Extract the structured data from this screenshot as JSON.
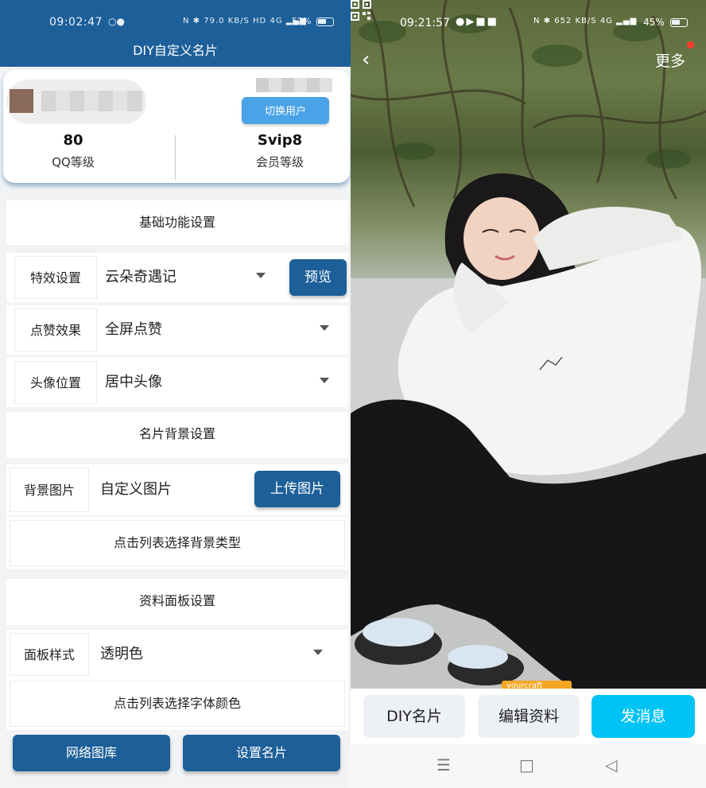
{
  "left": {
    "status": {
      "time": "09:02:47",
      "net_speed": "79.0 KB/S",
      "battery": "52%"
    },
    "title": "DIY自定义名片",
    "user": {
      "switch_button": "切换用户",
      "qq_level_value": "80",
      "qq_level_label": "QQ等级",
      "vip_value": "Svip8",
      "vip_label": "会员等级"
    },
    "basic_section": "基础功能设置",
    "effect": {
      "label": "特效设置",
      "value": "云朵奇遇记",
      "preview_button": "预览"
    },
    "like": {
      "label": "点赞效果",
      "value": "全屏点赞"
    },
    "avatar_pos": {
      "label": "头像位置",
      "value": "居中头像"
    },
    "bg_section": "名片背景设置",
    "bg_image": {
      "label": "背景图片",
      "value": "自定义图片",
      "upload_button": "上传图片"
    },
    "bg_type_hint": "点击列表选择背景类型",
    "panel_section": "资料面板设置",
    "panel_style": {
      "label": "面板样式",
      "value": "透明色"
    },
    "font_color_hint": "点击列表选择字体颜色",
    "gallery_button": "网络图库",
    "set_card_button": "设置名片"
  },
  "right": {
    "status": {
      "time": "09:21:57",
      "net_speed": "652 KB/S",
      "battery": "45%"
    },
    "more": "更多",
    "watermark": "yourcraft",
    "actions": {
      "diy": "DIY名片",
      "edit": "编辑资料",
      "message": "发消息"
    }
  },
  "colors": {
    "primary": "#1d5f99",
    "accent_cyan": "#00c3f5",
    "switch_blue": "#4aa3e6",
    "grey_button": "#edf0f5"
  },
  "icons": [
    "wechat-icon",
    "nfc-icon",
    "bluetooth-icon",
    "hd-icon",
    "signal-icon",
    "battery-icon",
    "back-icon",
    "qr-code-icon",
    "dropdown-caret-icon",
    "menu-icon",
    "home-icon",
    "nav-back-icon"
  ]
}
